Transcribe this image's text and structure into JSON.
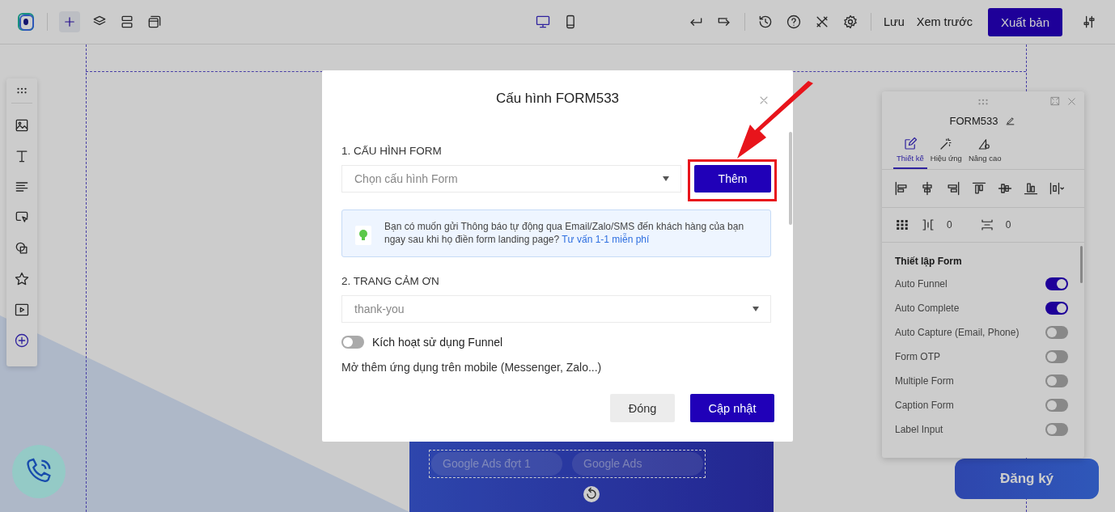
{
  "top_bar": {
    "devices": [
      {
        "kind": "desktop",
        "selected": true
      },
      {
        "kind": "mobile",
        "selected": false
      }
    ],
    "save": "Lưu",
    "preview": "Xem trước",
    "publish": "Xuất bản"
  },
  "canvas": {
    "fields": [
      "Google Ads đợt 1",
      "Google Ads"
    ],
    "submit": "Đăng ký"
  },
  "modal": {
    "title": "Cấu hình FORM533",
    "section_1": {
      "heading": "1. CẤU HÌNH FORM",
      "select": {
        "placeholder": "Chọn cấu hình Form"
      },
      "add_button": "Thêm"
    },
    "notice": {
      "text": "Bạn có muốn gửi Thông báo tự động qua Email/Zalo/SMS đến khách hàng của bạn ngay sau khi họ điền form landing page?",
      "link": "Tư vấn 1-1 miễn phí"
    },
    "section_2": {
      "heading": "2. TRANG CẢM ƠN",
      "select": {
        "value": "thank-you"
      },
      "funnel_toggle": {
        "label": "Kích hoạt sử dụng Funnel",
        "on": false
      },
      "more_apps": "Mở thêm ứng dụng trên mobile (Messenger, Zalo...)"
    },
    "buttons": [
      "Đóng",
      "Cập nhật"
    ]
  },
  "side_panel": {
    "title": "FORM533",
    "tabs": [
      {
        "label": "Thiết kế",
        "kind": "design",
        "selected": true
      },
      {
        "label": "Hiệu ứng",
        "kind": "effect",
        "selected": false
      },
      {
        "label": "Nâng cao",
        "kind": "advanced",
        "selected": false
      }
    ],
    "column_gap": "0",
    "row_gap": "0",
    "section_title": "Thiết lập Form",
    "settings": [
      {
        "label": "Auto Funnel",
        "on": true
      },
      {
        "label": "Auto Complete",
        "on": true
      },
      {
        "label": "Auto Capture (Email, Phone)",
        "on": false
      },
      {
        "label": "Form OTP",
        "on": false
      },
      {
        "label": "Multiple Form",
        "on": false
      },
      {
        "label": "Caption Form",
        "on": false
      },
      {
        "label": "Label Input",
        "on": false
      }
    ]
  }
}
